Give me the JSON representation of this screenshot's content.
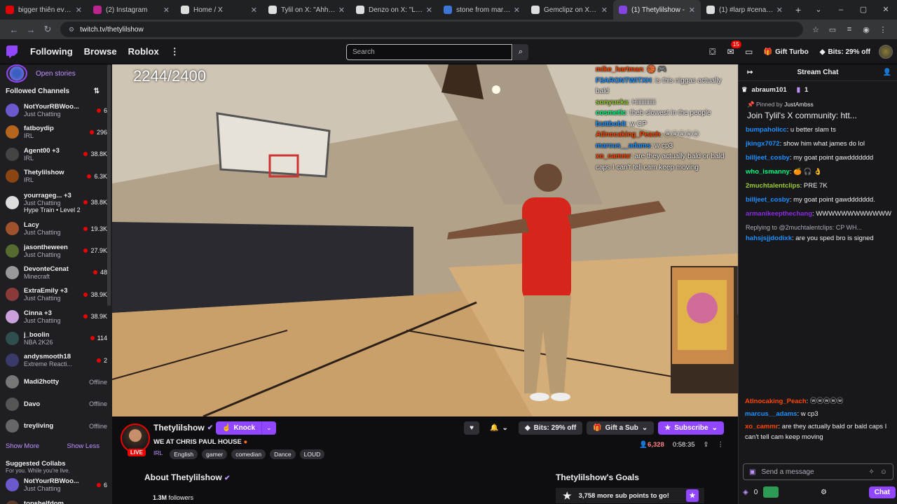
{
  "browser": {
    "tabs": [
      {
        "title": "bigger thiên everythi",
        "icon": "youtube-icon",
        "color": "#ff0000",
        "active": false
      },
      {
        "title": "(2) Instagram",
        "icon": "instagram-icon",
        "color": "#d6249f",
        "active": false
      },
      {
        "title": "Home / X",
        "icon": "x-icon",
        "color": "#ffffff",
        "active": false
      },
      {
        "title": "Tylil on X: \"Ahhhh STI",
        "icon": "x-icon",
        "color": "#ffffff",
        "active": false
      },
      {
        "title": "Denzo on X: \"Larry W",
        "icon": "x-icon",
        "color": "#ffffff",
        "active": false
      },
      {
        "title": "stone from mario - Go",
        "icon": "google-icon",
        "color": "#4285f4",
        "active": false
      },
      {
        "title": "Gemclipz on X: \"Digit",
        "icon": "x-icon",
        "color": "#ffffff",
        "active": false
      },
      {
        "title": "(1) Thetylilshow -",
        "icon": "twitch-icon",
        "color": "#9147ff",
        "active": true
      },
      {
        "title": "(1) #larp #cenat | Ka",
        "icon": "tiktok-icon",
        "color": "#ffffff",
        "active": false
      }
    ],
    "url": "twitch.tv/thetylilshow"
  },
  "topnav": {
    "following": "Following",
    "browse": "Browse",
    "roblox": "Roblox",
    "search_placeholder": "Search",
    "notif_count": "15",
    "gift_turbo": "Gift Turbo",
    "bits_offer": "Bits: 29% off"
  },
  "sidebar": {
    "open_stories": "Open stories",
    "followed_title": "Followed Channels",
    "channels": [
      {
        "name": "NotYourRBWoo...",
        "game": "Just Chatting",
        "viewers": "6",
        "live": true,
        "color": "#6a5acd"
      },
      {
        "name": "fatboydip",
        "game": "IRL",
        "viewers": "296",
        "live": true,
        "color": "#b5651d"
      },
      {
        "name": "Agent00 +3",
        "game": "IRL",
        "viewers": "38.8K",
        "live": true,
        "color": "#444"
      },
      {
        "name": "Thetylilshow",
        "game": "IRL",
        "viewers": "6.3K",
        "live": true,
        "color": "#8b4513"
      },
      {
        "name": "yourrageg... +3",
        "game": "Just Chatting",
        "viewers": "38.8K",
        "live": true,
        "color": "#ddd"
      },
      {
        "name": "Lacy",
        "game": "Just Chatting",
        "viewers": "19.3K",
        "live": true,
        "color": "#a0522d"
      },
      {
        "name": "jasontheween",
        "game": "Just Chatting",
        "viewers": "27.9K",
        "live": true,
        "color": "#556b2f"
      },
      {
        "name": "DevonteCenat",
        "game": "Minecraft",
        "viewers": "48",
        "live": true,
        "color": "#999"
      },
      {
        "name": "ExtraEmily +3",
        "game": "Just Chatting",
        "viewers": "38.9K",
        "live": true,
        "color": "#8b3a3a"
      },
      {
        "name": "Cinna +3",
        "game": "Just Chatting",
        "viewers": "38.9K",
        "live": true,
        "color": "#c9a0dc"
      },
      {
        "name": "j_boolin",
        "game": "NBA 2K26",
        "viewers": "114",
        "live": true,
        "color": "#2f4f4f"
      },
      {
        "name": "andysmooth18",
        "game": "Extreme Reacti...",
        "viewers": "2",
        "live": true,
        "color": "#3a3a6a"
      },
      {
        "name": "Madi2hotty",
        "game": "",
        "viewers": "Offline",
        "live": false,
        "color": "#777"
      },
      {
        "name": "Davo",
        "game": "",
        "viewers": "Offline",
        "live": false,
        "color": "#555"
      },
      {
        "name": "treyliving",
        "game": "",
        "viewers": "Offline",
        "live": false,
        "color": "#666"
      }
    ],
    "hype_train": "Hype Train • Level 2",
    "show_more": "Show More",
    "show_less": "Show Less",
    "suggested_title": "Suggested Collabs",
    "suggested_sub": "For you. While you're live.",
    "suggested": [
      {
        "name": "NotYourRBWoo...",
        "game": "Just Chatting",
        "viewers": "6",
        "color": "#6a5acd"
      },
      {
        "name": "topshelfdom",
        "game": "Just Chatting",
        "viewers": "6",
        "color": "#5a3a2a"
      }
    ]
  },
  "video": {
    "counter": "2244/2400",
    "overlay_chat": [
      {
        "user": "mike_hartman",
        "color": "#ff4500",
        "text": ": 🏀 🎮"
      },
      {
        "user": "F3ARONTWITXH",
        "color": "#1e90ff",
        "text": ": is this niggas actually bald"
      },
      {
        "user": "sonyucka",
        "color": "#9acd32",
        "text": ": Hiiiiiiiiiiii"
      },
      {
        "user": "cosmetic",
        "color": "#00ff7f",
        "text": ": theb slowest in the people"
      },
      {
        "user": "buttboblt",
        "color": "#1e90ff",
        "text": ": w CP"
      },
      {
        "user": "Atlnocaking_Peach",
        "color": "#ff4500",
        "text": ": ⓦⓦⓦⓦⓦ"
      },
      {
        "user": "marcus__adams",
        "color": "#1e90ff",
        "text": ": w cp3"
      },
      {
        "user": "xo_cammr",
        "color": "#ff4500",
        "text": ": are they actually bald or bald caps I can't tell cam keep moving"
      }
    ]
  },
  "streaminfo": {
    "name": "Thetylilshow",
    "knock": "Knock",
    "title": "WE AT CHRIS PAUL HOUSE",
    "live": "LIVE",
    "category": "IRL",
    "tags": [
      "English",
      "gamer",
      "comedian",
      "Dance",
      "LOUD"
    ],
    "bits": "Bits: 29% off",
    "gift_sub": "Gift a Sub",
    "subscribe": "Subscribe",
    "viewers": "6,328",
    "uptime": "0:58:35",
    "about": "About Thetylilshow",
    "followers_count": "1.3M",
    "followers_label": "followers",
    "goals_title": "Thetylilshow's Goals",
    "goal_text": "3,758 more sub points to go!"
  },
  "chat": {
    "title": "Stream Chat",
    "leader_name": "abraum101",
    "leader_count": "1",
    "pinned_by": "Pinned by",
    "pinned_user": "JustAmbss",
    "pinned_text": "Join Tylil's X community: htt...",
    "messages": [
      {
        "user": "bumpaholicc",
        "color": "#1e90ff",
        "text": ": u better slam ts"
      },
      {
        "user": "jkingx7072",
        "color": "#1e90ff",
        "text": ": show him what james do lol"
      },
      {
        "user": "billjeet_cosby",
        "color": "#1e90ff",
        "text": ": my goat point gawddddddd"
      },
      {
        "user": "who_ismanny",
        "color": "#00ff7f",
        "text": ": 🍊 🎧 👌"
      },
      {
        "user": "2muchtalentclips",
        "color": "#9acd32",
        "text": ": PRE 7K"
      },
      {
        "user": "billjeet_cosby",
        "color": "#1e90ff",
        "text": ": my goat point gawddddddd."
      },
      {
        "user": "armanikeepthechang",
        "color": "#8a2be2",
        "text": ": WWWWWWWWWWWW"
      }
    ],
    "reply_to": "Replying to @2muchtalentclips: CP WH...",
    "reply_msg": {
      "user": "hahsjsjjdodixk",
      "color": "#1e90ff",
      "text": ": are you sped bro is signed"
    },
    "lower_messages": [
      {
        "user": "Atlnocaking_Peach",
        "color": "#ff4500",
        "text": ": ⓦⓦⓦⓦⓦ"
      },
      {
        "user": "marcus__adams",
        "color": "#1e90ff",
        "text": ": w cp3"
      },
      {
        "user": "xo_cammr",
        "color": "#ff4500",
        "text": ": are they actually bald or bald caps I can't tell cam keep moving"
      }
    ],
    "send_placeholder": "Send a message",
    "points": "0",
    "chat_button": "Chat"
  }
}
